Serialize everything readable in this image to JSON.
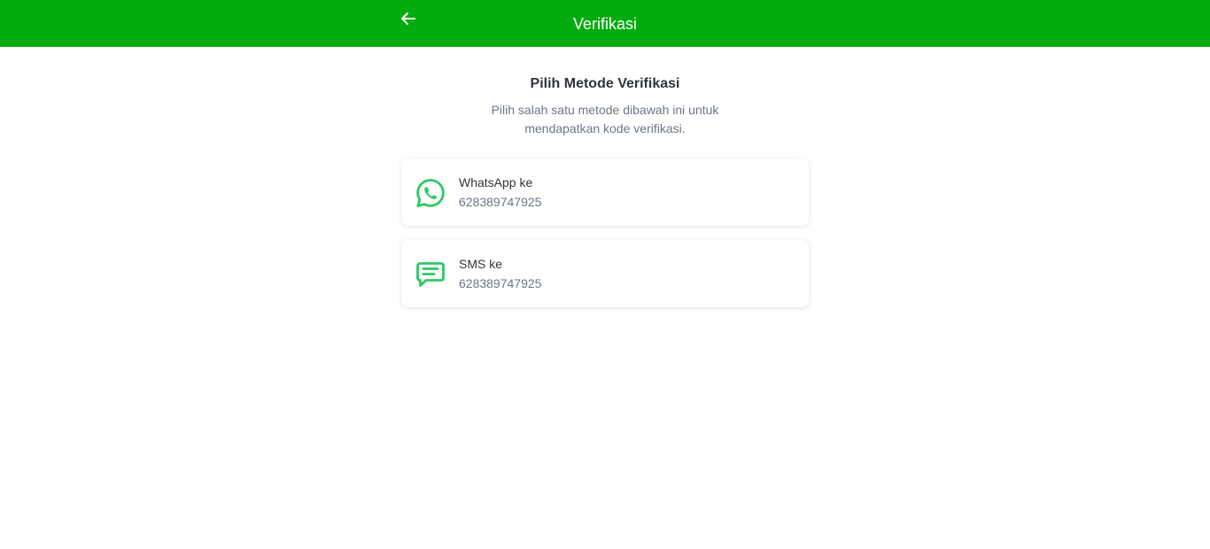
{
  "header": {
    "title": "Verifikasi",
    "back_icon": "arrow-left-icon",
    "background": "#03ac0e"
  },
  "main": {
    "heading": "Pilih Metode Verifikasi",
    "subtitle": "Pilih salah satu metode dibawah ini untuk mendapatkan kode verifikasi.",
    "methods": [
      {
        "icon": "whatsapp-icon",
        "label": "WhatsApp ke",
        "value": "628389747925"
      },
      {
        "icon": "chat-bubble-icon",
        "label": "SMS ke",
        "value": "628389747925"
      }
    ],
    "icon_color": "#2ec963"
  }
}
